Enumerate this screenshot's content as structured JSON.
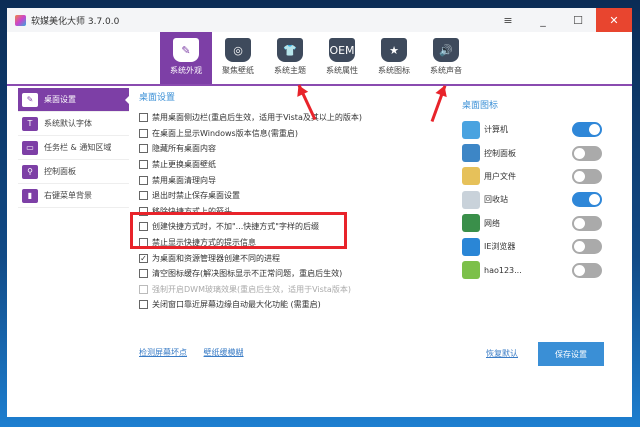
{
  "app": {
    "title": "软媒美化大师 3.7.0.0"
  },
  "window_controls": {
    "menu": "≡",
    "minimize": "_",
    "maximize": "☐",
    "close": "✕"
  },
  "toolbar": [
    {
      "label": "系统外观",
      "icon": "brush-icon",
      "glyph": "✎"
    },
    {
      "label": "聚焦壁纸",
      "icon": "wallpaper-icon",
      "glyph": "◎"
    },
    {
      "label": "系统主题",
      "icon": "tshirt-icon",
      "glyph": "👕"
    },
    {
      "label": "系统属性",
      "icon": "oem-icon",
      "glyph": "OEM"
    },
    {
      "label": "系统图标",
      "icon": "star-icon",
      "glyph": "★"
    },
    {
      "label": "系统声音",
      "icon": "speaker-icon",
      "glyph": "🔊"
    }
  ],
  "sidebar": [
    {
      "label": "桌面设置",
      "glyph": "✎"
    },
    {
      "label": "系统默认字体",
      "glyph": "T"
    },
    {
      "label": "任务栏 & 通知区域",
      "glyph": "▭"
    },
    {
      "label": "控制面板",
      "glyph": "⚲"
    },
    {
      "label": "右键菜单背景",
      "glyph": "▮"
    }
  ],
  "main": {
    "section_title": "桌面设置",
    "options": [
      {
        "label": "禁用桌面侧边栏(重启后生效，适用于Vista及其以上的版本)",
        "checked": false
      },
      {
        "label": "在桌面上显示Windows版本信息(需重启)",
        "checked": false
      },
      {
        "label": "隐藏所有桌面内容",
        "checked": false
      },
      {
        "label": "禁止更换桌面壁纸",
        "checked": false
      },
      {
        "label": "禁用桌面清理向导",
        "checked": false
      },
      {
        "label": "退出时禁止保存桌面设置",
        "checked": false
      },
      {
        "label": "移除快捷方式上的箭头",
        "checked": false
      },
      {
        "label": "创建快捷方式时，不加\"...快捷方式\"字样的后缀",
        "checked": false
      },
      {
        "label": "禁止显示快捷方式的提示信息",
        "checked": false
      },
      {
        "label": "为桌面和资源管理器创建不同的进程",
        "checked": true
      },
      {
        "label": "清空图标缓存(解决图标显示不正常问题，重启后生效)",
        "checked": false
      },
      {
        "label": "强制开启DWM玻璃效果(重启后生效，适用于Vista版本)",
        "checked": false,
        "disabled": true
      },
      {
        "label": "关闭窗口靠近屏幕边缘自动最大化功能 (需重启)",
        "checked": false
      }
    ],
    "links": [
      "检测屏幕坏点",
      "壁纸缓模糊"
    ]
  },
  "desktop_icons": {
    "title": "桌面图标",
    "items": [
      {
        "label": "计算机",
        "on": true,
        "color": "#4aa3e0"
      },
      {
        "label": "控制面板",
        "on": false,
        "color": "#3d86c6"
      },
      {
        "label": "用户文件",
        "on": false,
        "color": "#e6c15a"
      },
      {
        "label": "回收站",
        "on": true,
        "color": "#c9d2da"
      },
      {
        "label": "网络",
        "on": false,
        "color": "#3a8f4a"
      },
      {
        "label": "IE浏览器",
        "on": false,
        "color": "#2a86d6"
      },
      {
        "label": "hao123...",
        "on": false,
        "color": "#7cc04a"
      }
    ]
  },
  "footer": {
    "restore": "恢复默认",
    "save": "保存设置"
  }
}
